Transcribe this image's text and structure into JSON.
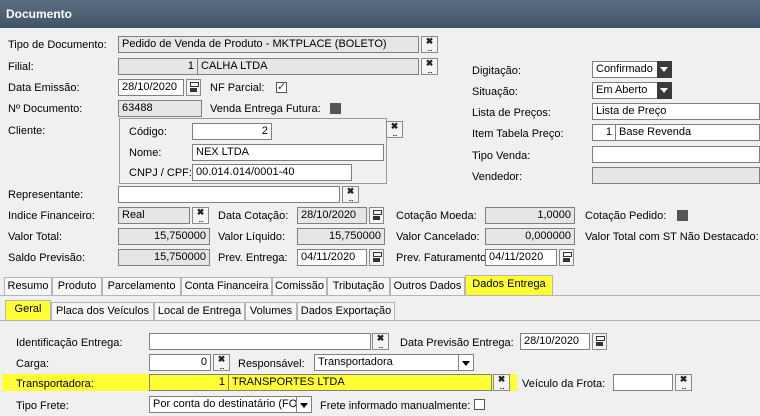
{
  "window": {
    "title": "Documento"
  },
  "form": {
    "tipo_documento": {
      "label": "Tipo de Documento:",
      "value": "Pedido de Venda de Produto - MKTPLACE (BOLETO)"
    },
    "filial": {
      "label": "Filial:",
      "code": "1",
      "name": "CALHA LTDA"
    },
    "data_emissao": {
      "label": "Data Emissão:",
      "value": "28/10/2020"
    },
    "nf_parcial": {
      "label": "NF Parcial:",
      "checked": true
    },
    "num_documento": {
      "label": "Nº Documento:",
      "value": "63488"
    },
    "venda_entrega_futura": {
      "label": "Venda Entrega Futura:"
    },
    "cliente": {
      "label": "Cliente:",
      "codigo_label": "Código:",
      "codigo": "2",
      "nome_label": "Nome:",
      "nome": "NEX LTDA",
      "cnpj_label": "CNPJ / CPF:",
      "cnpj": "00.014.014/0001-40"
    },
    "representante": {
      "label": "Representante:",
      "value": ""
    },
    "indice_financeiro": {
      "label": "Indice Financeiro:",
      "value": "Real"
    },
    "data_cotacao": {
      "label": "Data Cotação:",
      "value": "28/10/2020"
    },
    "cotacao_moeda": {
      "label": "Cotação Moeda:",
      "value": "1,0000"
    },
    "cotacao_pedido": {
      "label": "Cotação Pedido:"
    },
    "valor_total": {
      "label": "Valor Total:",
      "value": "15,750000"
    },
    "valor_liquido": {
      "label": "Valor Líquido:",
      "value": "15,750000"
    },
    "valor_cancelado": {
      "label": "Valor Cancelado:",
      "value": "0,000000"
    },
    "valor_total_st": {
      "label": "Valor Total com ST Não Destacado:"
    },
    "saldo_previsao": {
      "label": "Saldo Previsão:",
      "value": "15,750000"
    },
    "prev_entrega": {
      "label": "Prev. Entrega:",
      "value": "04/11/2020"
    },
    "prev_faturamento": {
      "label": "Prev. Faturamento:",
      "value": "04/11/2020"
    },
    "digitacao": {
      "label": "Digitação:",
      "value": "Confirmado"
    },
    "situacao": {
      "label": "Situação:",
      "value": "Em Aberto"
    },
    "lista_precos": {
      "label": "Lista de Preços:",
      "value": "Lista de Preço"
    },
    "item_tabela_preco": {
      "label": "Item Tabela Preço:",
      "code": "1",
      "name": "Base Revenda"
    },
    "tipo_venda": {
      "label": "Tipo Venda:",
      "value": ""
    },
    "vendedor": {
      "label": "Vendedor:",
      "value": ""
    }
  },
  "tabs": [
    "Resumo",
    "Produto",
    "Parcelamento",
    "Conta Financeira",
    "Comissão",
    "Tributação",
    "Outros Dados",
    "Dados Entrega"
  ],
  "active_tab": "Dados Entrega",
  "subtabs": [
    "Geral",
    "Placa dos Veículos",
    "Local de Entrega",
    "Volumes",
    "Dados Exportação"
  ],
  "active_subtab": "Geral",
  "entrega": {
    "identificacao": {
      "label": "Identificação Entrega:",
      "value": ""
    },
    "data_previsao": {
      "label": "Data Previsão Entrega:",
      "value": "28/10/2020"
    },
    "carga": {
      "label": "Carga:",
      "value": "0"
    },
    "responsavel": {
      "label": "Responsável:",
      "value": "Transportadora"
    },
    "transportadora": {
      "label": "Transportadora:",
      "code": "1",
      "name": "TRANSPORTES LTDA"
    },
    "veiculo_frota": {
      "label": "Veículo da Frota:",
      "value": ""
    },
    "tipo_frete": {
      "label": "Tipo Frete:",
      "value": "Por conta do destinatário (FO"
    },
    "frete_manual": {
      "label": "Frete informado manualmente:"
    }
  },
  "colors": {
    "highlight": "#ffff33",
    "titlebar": "#4a5d71"
  }
}
